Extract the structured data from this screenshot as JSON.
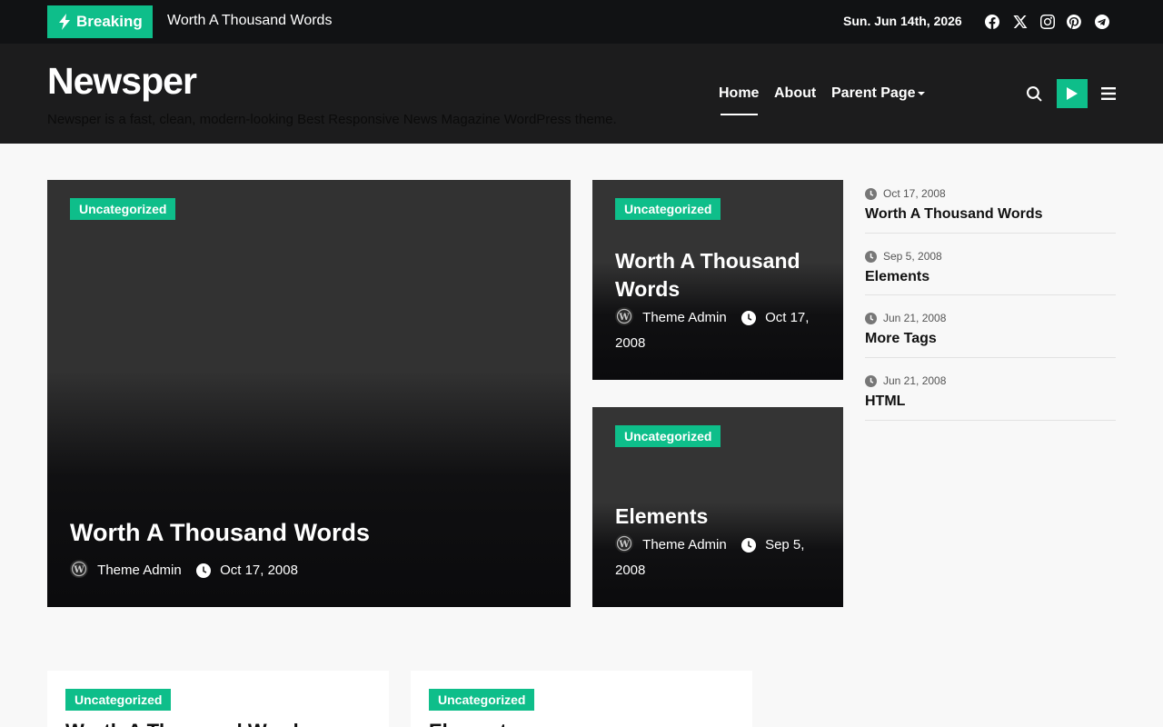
{
  "topbar": {
    "breaking_label": "Breaking",
    "breaking_text": "Worth A Thousand Words",
    "date": "Sun. Jun 14th, 2026",
    "social_icons": [
      "facebook-icon",
      "x-twitter-icon",
      "instagram-icon",
      "pinterest-icon",
      "telegram-icon"
    ]
  },
  "header": {
    "site_title": "Newsper",
    "tagline": "Newsper is a fast, clean, modern-looking Best Responsive News Magazine WordPress theme.",
    "nav": [
      {
        "label": "Home"
      },
      {
        "label": "About"
      },
      {
        "label": "Parent Page"
      }
    ]
  },
  "featured": {
    "main": {
      "category": "Uncategorized",
      "title": "Worth A Thousand Words",
      "author": "Theme Admin",
      "date": "Oct 17, 2008"
    },
    "side": [
      {
        "category": "Uncategorized",
        "title": "Worth A Thousand Words",
        "author": "Theme Admin",
        "date": "Oct 17, 2008"
      },
      {
        "category": "Uncategorized",
        "title": "Elements",
        "author": "Theme Admin",
        "date": "Sep 5, 2008"
      }
    ]
  },
  "sidebar": {
    "items": [
      {
        "date": "Oct 17, 2008",
        "title": "Worth A Thousand Words"
      },
      {
        "date": "Sep 5, 2008",
        "title": "Elements"
      },
      {
        "date": "Jun 21, 2008",
        "title": "More Tags"
      },
      {
        "date": "Jun 21, 2008",
        "title": "HTML"
      }
    ]
  },
  "grid": [
    {
      "category": "Uncategorized",
      "title": "Worth A Thousand Words"
    },
    {
      "category": "Uncategorized",
      "title": "Elements"
    }
  ],
  "colors": {
    "accent": "#0ebe8a",
    "topbar": "#111214",
    "header": "#1c1c1d"
  }
}
